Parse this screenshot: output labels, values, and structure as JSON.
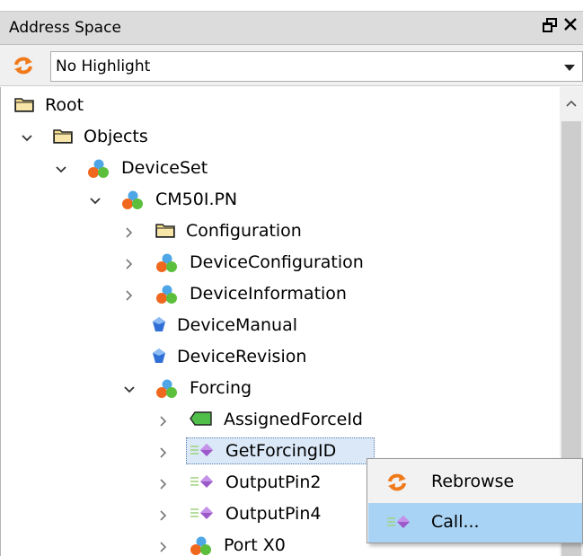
{
  "panel": {
    "title": "Address Space",
    "pin_glyph": "🗗",
    "close_glyph": "✕"
  },
  "highlight": {
    "selected": "No Highlight",
    "refresh_icon": "refresh-icon"
  },
  "tree": {
    "nodes": [
      {
        "label": "Root",
        "icon": "folder-icon",
        "expander": "none"
      },
      {
        "label": "Objects",
        "icon": "folder-icon",
        "expander": "expanded"
      },
      {
        "label": "DeviceSet",
        "icon": "object-icon",
        "expander": "expanded"
      },
      {
        "label": "CM50I.PN",
        "icon": "object-icon",
        "expander": "expanded"
      },
      {
        "label": "Configuration",
        "icon": "folder-icon",
        "expander": "collapsed"
      },
      {
        "label": "DeviceConfiguration",
        "icon": "object-icon",
        "expander": "collapsed"
      },
      {
        "label": "DeviceInformation",
        "icon": "object-icon",
        "expander": "collapsed"
      },
      {
        "label": "DeviceManual",
        "icon": "property-icon",
        "expander": "none"
      },
      {
        "label": "DeviceRevision",
        "icon": "property-icon",
        "expander": "none"
      },
      {
        "label": "Forcing",
        "icon": "object-icon",
        "expander": "expanded"
      },
      {
        "label": "AssignedForceId",
        "icon": "variable-icon",
        "expander": "collapsed"
      },
      {
        "label": "GetForcingID",
        "icon": "method-icon",
        "expander": "collapsed",
        "selected": true
      },
      {
        "label": "OutputPin2",
        "icon": "method-icon",
        "expander": "collapsed"
      },
      {
        "label": "OutputPin4",
        "icon": "method-icon",
        "expander": "collapsed"
      },
      {
        "label": "Port X0",
        "icon": "object-icon",
        "expander": "collapsed"
      }
    ]
  },
  "context_menu": {
    "items": [
      {
        "label": "Rebrowse",
        "icon": "refresh-icon"
      },
      {
        "label": "Call...",
        "icon": "method-icon",
        "hovered": true
      }
    ]
  },
  "colors": {
    "title_bar": "#dcdcdc",
    "selection": "#dbe8f7",
    "menu_hover": "#a9d3f4",
    "refresh_orange": "#f07a1a",
    "method_purple": "#9b59c9"
  }
}
